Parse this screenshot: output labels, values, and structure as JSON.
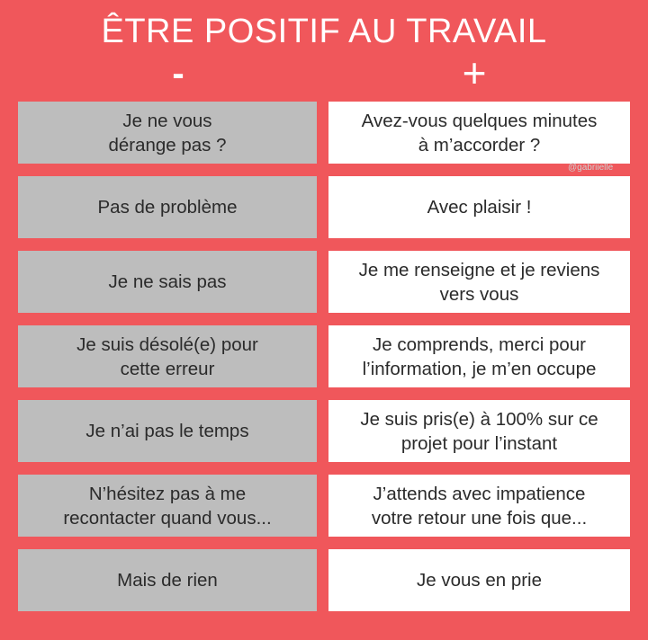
{
  "title": "ÊTRE POSITIF AU TRAVAIL",
  "columns": {
    "minus_sign": "-",
    "plus_sign": "+"
  },
  "rows": [
    {
      "minus": "Je ne vous\ndérange pas ?",
      "plus": "Avez-vous quelques minutes\nà m’accorder ?"
    },
    {
      "minus": "Pas de problème",
      "plus": "Avec plaisir !"
    },
    {
      "minus": "Je ne sais pas",
      "plus": "Je me renseigne et je reviens\nvers vous"
    },
    {
      "minus": "Je suis désolé(e) pour\ncette erreur",
      "plus": "Je comprends, merci pour\nl’information, je m’en occupe"
    },
    {
      "minus": "Je n’ai pas le temps",
      "plus": "Je suis pris(e) à 100% sur ce\nprojet pour l’instant"
    },
    {
      "minus": "N’hésitez pas à me\nrecontacter quand vous...",
      "plus": "J’attends avec impatience\nvotre retour une fois que..."
    },
    {
      "minus": "Mais de rien",
      "plus": "Je vous en prie"
    }
  ],
  "watermark": "@gabriielle",
  "colors": {
    "background": "#f0575b",
    "minus_cell": "#bdbdbd",
    "plus_cell": "#ffffff",
    "text": "#2b2b2b"
  }
}
